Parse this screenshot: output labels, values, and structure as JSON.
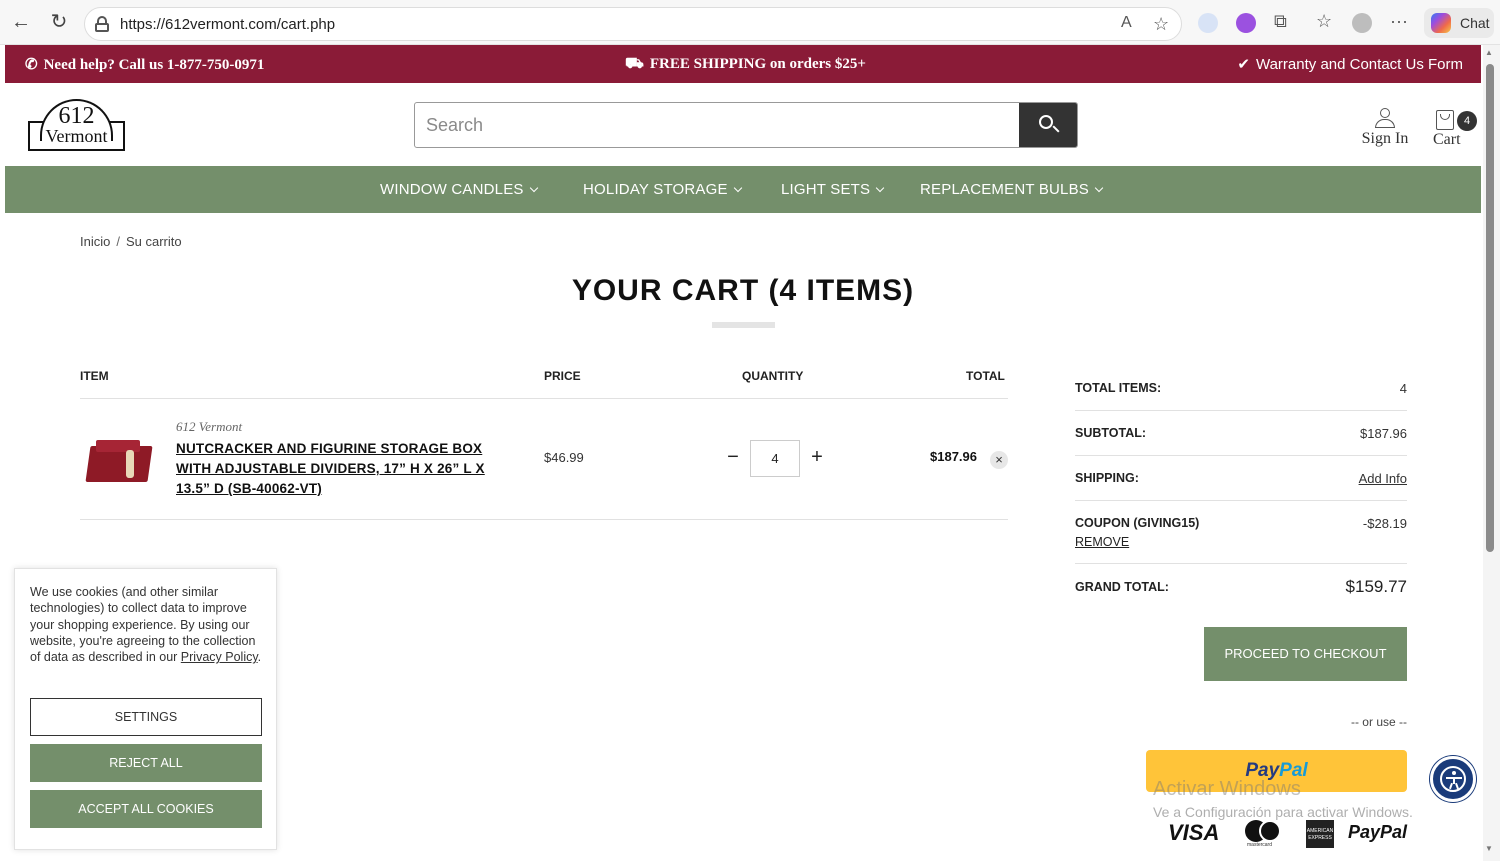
{
  "browser": {
    "url": "https://612vermont.com/cart.php",
    "chat_label": "Chat"
  },
  "promo": {
    "help": "Need help? Call us 1-877-750-0971",
    "shipping": "FREE SHIPPING on orders $25+",
    "warranty": "Warranty and Contact Us Form"
  },
  "header": {
    "logo_number": "612",
    "logo_name": "Vermont",
    "search_placeholder": "Search",
    "sign_in": "Sign In",
    "cart_label": "Cart",
    "cart_count": "4"
  },
  "nav": {
    "items": [
      {
        "label": "WINDOW CANDLES"
      },
      {
        "label": "HOLIDAY STORAGE"
      },
      {
        "label": "LIGHT SETS"
      },
      {
        "label": "REPLACEMENT BULBS"
      }
    ]
  },
  "breadcrumb": {
    "home": "Inicio",
    "separator": "/",
    "current": "Su carrito"
  },
  "page_title": "YOUR CART (4 ITEMS)",
  "table": {
    "headers": {
      "item": "ITEM",
      "price": "PRICE",
      "quantity": "QUANTITY",
      "total": "TOTAL"
    },
    "rows": [
      {
        "brand": "612 Vermont",
        "name": "NUTCRACKER AND FIGURINE STORAGE BOX WITH ADJUSTABLE DIVIDERS, 17” H X 26” L X 13.5” D (SB-40062-VT)",
        "price": "$46.99",
        "quantity": "4",
        "total": "$187.96",
        "minus": "−",
        "plus": "+",
        "remove": "×"
      }
    ]
  },
  "summary": {
    "total_items_label": "TOTAL ITEMS:",
    "total_items_value": "4",
    "subtotal_label": "SUBTOTAL:",
    "subtotal_value": "$187.96",
    "shipping_label": "SHIPPING:",
    "shipping_value": "Add Info",
    "coupon_label": "COUPON (GIVING15)",
    "coupon_value": "-$28.19",
    "coupon_remove": "REMOVE",
    "grand_total_label": "GRAND TOTAL:",
    "grand_total_value": "$159.77",
    "checkout_label": "PROCEED TO CHECKOUT",
    "or_use": "-- or use --",
    "paypal_1": "Pay",
    "paypal_2": "Pal"
  },
  "payment_methods": {
    "visa": "VISA",
    "mastercard": "mastercard",
    "amex": "AMERICAN EXPRESS",
    "paypal": "PayPal"
  },
  "windows_watermark": {
    "line1": "Activar Windows",
    "line2": "Ve a Configuración para activar Windows."
  },
  "cookie": {
    "text_before": "We use cookies (and other similar technologies) to collect data to improve your shopping experience. By using our website, you're agreeing to the collection of data as described in our ",
    "policy_link": "Privacy Policy",
    "text_after": ".",
    "settings": "SETTINGS",
    "reject": "REJECT ALL",
    "accept": "ACCEPT ALL COOKIES"
  },
  "colors": {
    "promo_bar": "#8a1b37",
    "nav_green": "#748f6b",
    "paypal_yellow": "#ffc439"
  }
}
